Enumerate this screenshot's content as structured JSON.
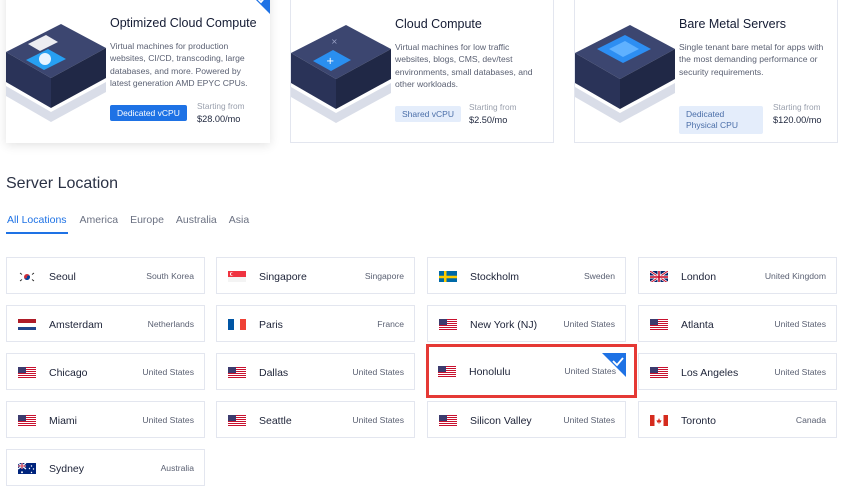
{
  "products": [
    {
      "title": "Optimized Cloud Compute",
      "description": "Virtual machines for production websites, CI/CD, transcoding, large databases, and more. Powered by latest generation AMD EPYC CPUs.",
      "badge": "Dedicated vCPU",
      "price_label": "Starting from",
      "price": "$28.00/mo",
      "selected": true
    },
    {
      "title": "Cloud Compute",
      "description": "Virtual machines for low traffic websites, blogs, CMS, dev/test environments, small databases, and other workloads.",
      "badge": "Shared vCPU",
      "price_label": "Starting from",
      "price": "$2.50/mo",
      "selected": false
    },
    {
      "title": "Bare Metal Servers",
      "description": "Single tenant bare metal for apps with the most demanding performance or security requirements.",
      "badge": "Dedicated Physical CPU",
      "price_label": "Starting from",
      "price": "$120.00/mo",
      "selected": false
    }
  ],
  "server_location": {
    "title": "Server Location",
    "tabs": [
      "All Locations",
      "America",
      "Europe",
      "Australia",
      "Asia"
    ],
    "active_tab": "All Locations",
    "locations": [
      {
        "city": "Seoul",
        "country": "South Korea",
        "flag": "kr"
      },
      {
        "city": "Singapore",
        "country": "Singapore",
        "flag": "sg"
      },
      {
        "city": "Stockholm",
        "country": "Sweden",
        "flag": "se"
      },
      {
        "city": "London",
        "country": "United Kingdom",
        "flag": "gb"
      },
      {
        "city": "Amsterdam",
        "country": "Netherlands",
        "flag": "nl"
      },
      {
        "city": "Paris",
        "country": "France",
        "flag": "fr"
      },
      {
        "city": "New York (NJ)",
        "country": "United States",
        "flag": "us"
      },
      {
        "city": "Atlanta",
        "country": "United States",
        "flag": "us"
      },
      {
        "city": "Chicago",
        "country": "United States",
        "flag": "us"
      },
      {
        "city": "Dallas",
        "country": "United States",
        "flag": "us"
      },
      {
        "city": "Honolulu",
        "country": "United States",
        "flag": "us",
        "selected": true
      },
      {
        "city": "Los Angeles",
        "country": "United States",
        "flag": "us"
      },
      {
        "city": "Miami",
        "country": "United States",
        "flag": "us"
      },
      {
        "city": "Seattle",
        "country": "United States",
        "flag": "us"
      },
      {
        "city": "Silicon Valley",
        "country": "United States",
        "flag": "us"
      },
      {
        "city": "Toronto",
        "country": "Canada",
        "flag": "ca"
      },
      {
        "city": "Sydney",
        "country": "Australia",
        "flag": "au"
      }
    ]
  },
  "colors": {
    "accent": "#1e72e5",
    "highlight_box": "#e53935"
  }
}
